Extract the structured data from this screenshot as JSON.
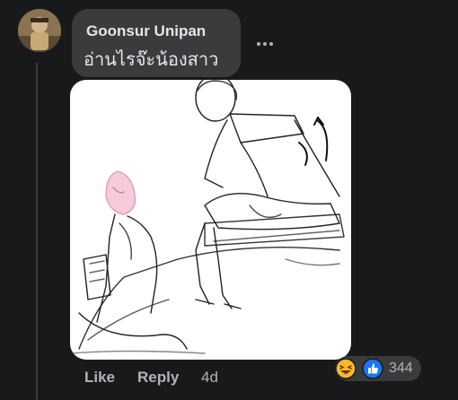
{
  "comment": {
    "author": "Goonsur Unipan",
    "text": "อ่านไรจ๊ะน้องสาว",
    "image_description": "",
    "actions": {
      "like_label": "Like",
      "reply_label": "Reply",
      "timestamp": "4d"
    },
    "reactions": {
      "count": "344",
      "icons": [
        "haha-icon",
        "like-icon"
      ]
    }
  },
  "colors": {
    "background": "#18191a",
    "bubble": "#3a3b3c",
    "primary_text": "#e4e6eb",
    "secondary_text": "#b0b3b8",
    "like_blue": "#1877f2",
    "haha_yellow": "#f7b928"
  }
}
